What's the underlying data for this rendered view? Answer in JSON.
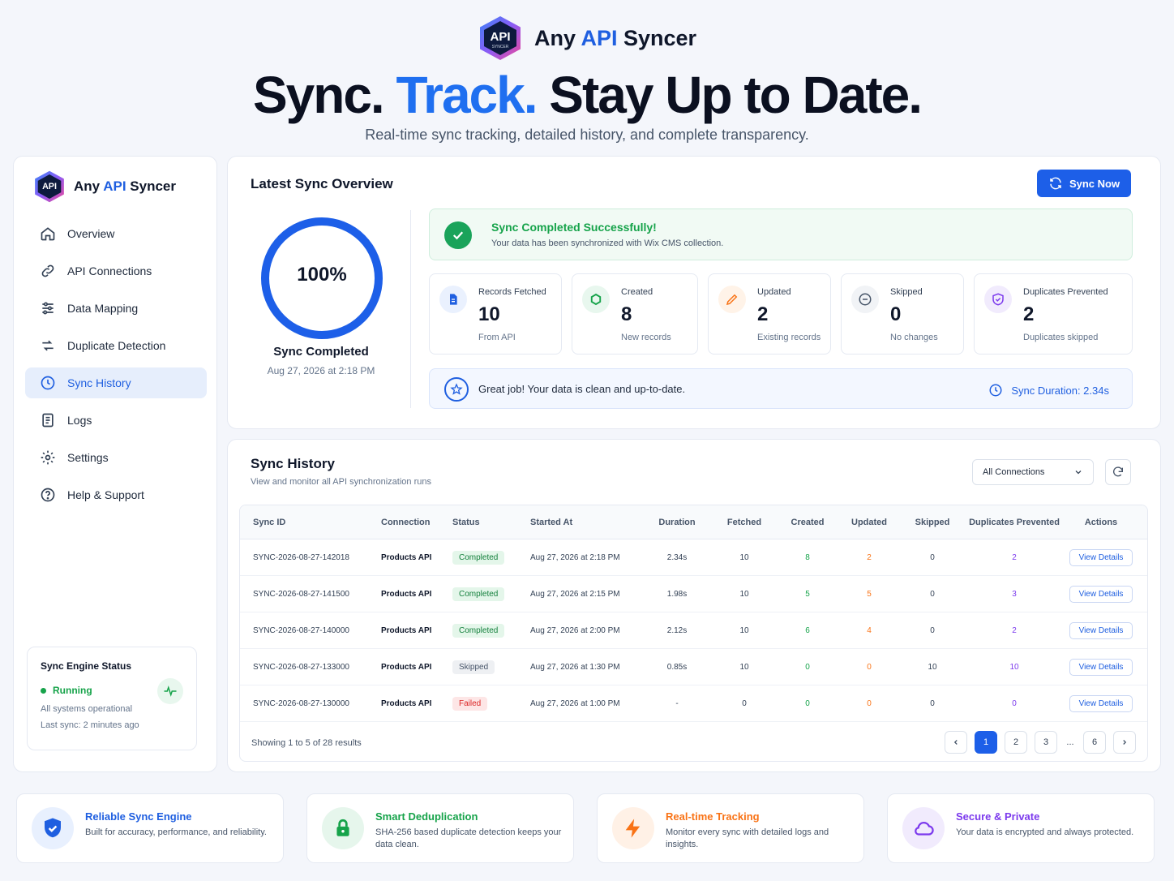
{
  "hero": {
    "brand_prefix": "Any ",
    "brand_accent": "API",
    "brand_suffix": " Syncer",
    "logo_text": "API",
    "logo_subtext": "SYNCER",
    "title_part1": "Sync. ",
    "title_accent": "Track.",
    "title_part2": " Stay Up to Date.",
    "subtitle": "Real-time sync tracking, detailed history, and complete transparency."
  },
  "sidebar": {
    "brand_prefix": "Any ",
    "brand_accent": "API",
    "brand_suffix": " Syncer",
    "items": [
      {
        "label": "Overview",
        "icon": "home-icon"
      },
      {
        "label": "API Connections",
        "icon": "link-icon"
      },
      {
        "label": "Data Mapping",
        "icon": "sliders-icon"
      },
      {
        "label": "Duplicate Detection",
        "icon": "duplicate-icon"
      },
      {
        "label": "Sync History",
        "icon": "clock-icon"
      },
      {
        "label": "Logs",
        "icon": "document-icon"
      },
      {
        "label": "Settings",
        "icon": "gear-icon"
      },
      {
        "label": "Help & Support",
        "icon": "help-icon"
      }
    ],
    "active_index": 4,
    "engine": {
      "title": "Sync Engine Status",
      "state": "Running",
      "message": "All systems operational",
      "last_sync": "Last sync: 2 minutes ago"
    }
  },
  "overview": {
    "title": "Latest Sync Overview",
    "sync_button": "Sync Now",
    "progress_percent": 100,
    "progress_label": "100%",
    "status_label": "Sync Completed",
    "date": "Aug 27, 2026 at 2:18 PM",
    "success_title": "Sync Completed Successfully!",
    "success_message": "Your data has been synchronized with Wix CMS collection.",
    "stats": [
      {
        "label": "Records Fetched",
        "value": "10",
        "sub": "From API",
        "icon": "file-icon",
        "color": "#1f5fe0"
      },
      {
        "label": "Created",
        "value": "8",
        "sub": "New records",
        "icon": "plus-circle-icon",
        "color": "#16a34a"
      },
      {
        "label": "Updated",
        "value": "2",
        "sub": "Existing records",
        "icon": "pencil-icon",
        "color": "#f97316"
      },
      {
        "label": "Skipped",
        "value": "0",
        "sub": "No changes",
        "icon": "minus-circle-icon",
        "color": "#475569"
      },
      {
        "label": "Duplicates Prevented",
        "value": "2",
        "sub": "Duplicates skipped",
        "icon": "shield-icon",
        "color": "#7c3aed"
      }
    ],
    "great_message": "Great job! Your data is clean and up-to-date.",
    "duration": "Sync Duration: 2.34s"
  },
  "history": {
    "title": "Sync History",
    "subtitle": "View and monitor all API synchronization runs",
    "filter": "All Connections",
    "columns": [
      "Sync ID",
      "Connection",
      "Status",
      "Started At",
      "Duration",
      "Fetched",
      "Created",
      "Updated",
      "Skipped",
      "Duplicates Prevented",
      "Actions"
    ],
    "rows": [
      {
        "id": "SYNC-2026-08-27-142018",
        "connection": "Products API",
        "status": "Completed",
        "started": "Aug 27, 2026 at 2:18 PM",
        "duration": "2.34s",
        "fetched": "10",
        "created": "8",
        "updated": "2",
        "skipped": "0",
        "duplicates": "2",
        "action": "View Details"
      },
      {
        "id": "SYNC-2026-08-27-141500",
        "connection": "Products API",
        "status": "Completed",
        "started": "Aug 27, 2026 at 2:15 PM",
        "duration": "1.98s",
        "fetched": "10",
        "created": "5",
        "updated": "5",
        "skipped": "0",
        "duplicates": "3",
        "action": "View Details"
      },
      {
        "id": "SYNC-2026-08-27-140000",
        "connection": "Products API",
        "status": "Completed",
        "started": "Aug 27, 2026 at 2:00 PM",
        "duration": "2.12s",
        "fetched": "10",
        "created": "6",
        "updated": "4",
        "skipped": "0",
        "duplicates": "2",
        "action": "View Details"
      },
      {
        "id": "SYNC-2026-08-27-133000",
        "connection": "Products API",
        "status": "Skipped",
        "started": "Aug 27, 2026 at 1:30 PM",
        "duration": "0.85s",
        "fetched": "10",
        "created": "0",
        "updated": "0",
        "skipped": "10",
        "duplicates": "10",
        "action": "View Details"
      },
      {
        "id": "SYNC-2026-08-27-130000",
        "connection": "Products API",
        "status": "Failed",
        "started": "Aug 27, 2026 at 1:00 PM",
        "duration": "-",
        "fetched": "0",
        "created": "0",
        "updated": "0",
        "skipped": "0",
        "duplicates": "0",
        "action": "View Details"
      }
    ],
    "showing": "Showing 1 to 5 of 28 results",
    "pages": [
      "1",
      "2",
      "3",
      "...",
      "6"
    ],
    "current_page": "1"
  },
  "features": [
    {
      "title": "Reliable Sync Engine",
      "desc": "Built for accuracy, performance, and reliability.",
      "color": "#1f5fe0",
      "bg": "#e8f0fe",
      "icon": "shield-check-icon"
    },
    {
      "title": "Smart Deduplication",
      "desc": "SHA-256 based duplicate detection keeps your data clean.",
      "color": "#16a34a",
      "bg": "#e6f6ec",
      "icon": "lock-icon"
    },
    {
      "title": "Real-time Tracking",
      "desc": "Monitor every sync with detailed logs and insights.",
      "color": "#f97316",
      "bg": "#fff1e6",
      "icon": "bolt-icon"
    },
    {
      "title": "Secure & Private",
      "desc": "Your data is encrypted and always protected.",
      "color": "#7c3aed",
      "bg": "#f1ebfd",
      "icon": "cloud-icon"
    }
  ]
}
